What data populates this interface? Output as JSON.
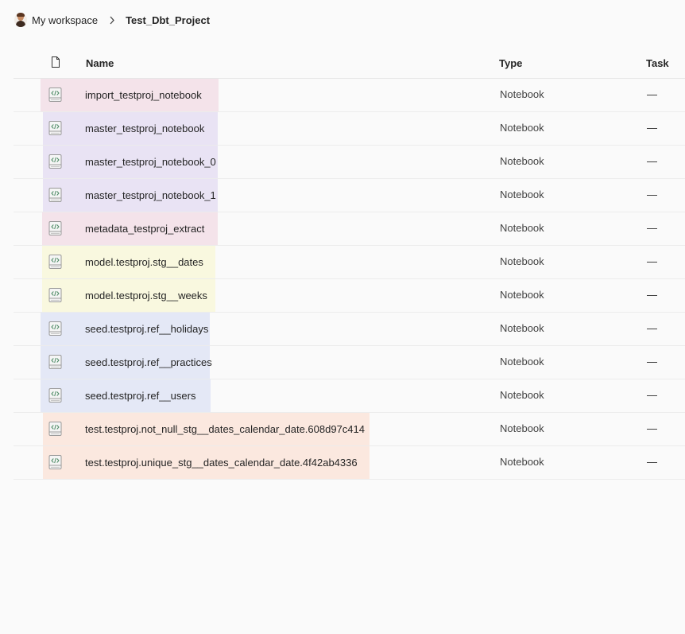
{
  "breadcrumb": {
    "workspace": "My workspace",
    "project": "Test_Dbt_Project"
  },
  "table": {
    "columns": {
      "name": "Name",
      "type": "Type",
      "task": "Task"
    },
    "rows": [
      {
        "name": "import_testproj_notebook",
        "type": "Notebook",
        "task": "—",
        "highlight": "pink"
      },
      {
        "name": "master_testproj_notebook",
        "type": "Notebook",
        "task": "—",
        "highlight": "purple"
      },
      {
        "name": "master_testproj_notebook_0",
        "type": "Notebook",
        "task": "—",
        "highlight": "purple"
      },
      {
        "name": "master_testproj_notebook_1",
        "type": "Notebook",
        "task": "—",
        "highlight": "purple"
      },
      {
        "name": "metadata_testproj_extract",
        "type": "Notebook",
        "task": "—",
        "highlight": "pink"
      },
      {
        "name": "model.testproj.stg__dates",
        "type": "Notebook",
        "task": "—",
        "highlight": "yellow"
      },
      {
        "name": "model.testproj.stg__weeks",
        "type": "Notebook",
        "task": "—",
        "highlight": "yellow"
      },
      {
        "name": "seed.testproj.ref__holidays",
        "type": "Notebook",
        "task": "—",
        "highlight": "blue"
      },
      {
        "name": "seed.testproj.ref__practices",
        "type": "Notebook",
        "task": "—",
        "highlight": "blue"
      },
      {
        "name": "seed.testproj.ref__users",
        "type": "Notebook",
        "task": "—",
        "highlight": "blue"
      },
      {
        "name": "test.testproj.not_null_stg__dates_calendar_date.608d97c414",
        "type": "Notebook",
        "task": "—",
        "highlight": "peach"
      },
      {
        "name": "test.testproj.unique_stg__dates_calendar_date.4f42ab4336",
        "type": "Notebook",
        "task": "—",
        "highlight": "peach"
      }
    ]
  },
  "icons": {
    "header_icon": "file-icon",
    "row_icon": "notebook-icon",
    "separator": "chevron-right-icon"
  }
}
